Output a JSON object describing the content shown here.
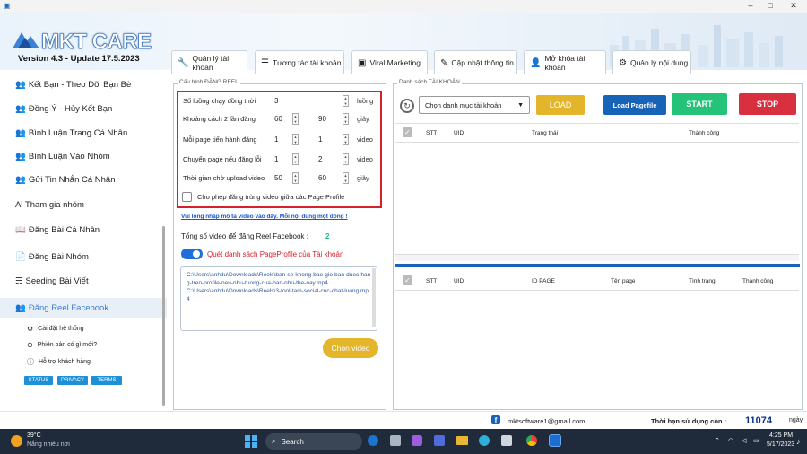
{
  "app": {
    "name": "MKT CARE",
    "version": "Version 4.3 - Update 17.5.2023"
  },
  "window": {
    "minimize": "–",
    "maximize": "□",
    "close": "✕"
  },
  "tabs": [
    {
      "label": "Quản lý tài khoản",
      "icon": "wrench-icon",
      "glyph": "🔧"
    },
    {
      "label": "Tương tác tài khoản",
      "icon": "list-icon",
      "glyph": "☰"
    },
    {
      "label": "Viral Marketing",
      "icon": "browser-icon",
      "glyph": "▣"
    },
    {
      "label": "Cập nhật thông tin",
      "icon": "pencil-icon",
      "glyph": "✎"
    },
    {
      "label": "Mở khóa tài khoản",
      "icon": "user-icon",
      "glyph": "👤"
    },
    {
      "label": "Quản lý nội dung",
      "icon": "gear-icon",
      "glyph": "⚙"
    }
  ],
  "sidebar": {
    "items": [
      {
        "label": "Kết Bạn - Theo Dõi Bạn Bè",
        "glyph": "👥"
      },
      {
        "label": "Đồng Ý - Hủy Kết Bạn",
        "glyph": "👥"
      },
      {
        "label": "Bình Luận Trang Cá Nhân",
        "glyph": "👥"
      },
      {
        "label": "Bình Luận Vào Nhóm",
        "glyph": "👥"
      },
      {
        "label": "Gửi Tin Nhắn Cá Nhân",
        "glyph": "👥"
      },
      {
        "label": "Tham gia nhóm",
        "glyph": "Aᴵ"
      },
      {
        "label": "Đăng Bài Cá Nhân",
        "glyph": "📖"
      },
      {
        "label": "Đăng Bài Nhóm",
        "glyph": "📄"
      },
      {
        "label": "Seeding Bài Viết",
        "glyph": "☴"
      },
      {
        "label": "Đăng Reel Facebook",
        "glyph": "👥"
      }
    ],
    "sub": [
      {
        "label": "Cài đặt hệ thống",
        "glyph": "⚙"
      },
      {
        "label": "Phiên bản có gì mới?",
        "glyph": "⊙"
      },
      {
        "label": "Hỗ trợ khách hàng",
        "glyph": "ⓘ"
      }
    ],
    "pills": [
      "STATUS",
      "PRIVACY",
      "TERMS"
    ]
  },
  "config": {
    "title": "Cấu hình ĐĂNG REEL",
    "rows": [
      {
        "label": "Số luồng chạy đồng thời",
        "v1": "3",
        "v2": "",
        "unit": "luồng"
      },
      {
        "label": "Khoảng cách 2 lần đăng",
        "v1": "60",
        "v2": "90",
        "unit": "giây"
      },
      {
        "label": "Mỗi page tiến hành đăng",
        "v1": "1",
        "v2": "1",
        "unit": "video"
      },
      {
        "label": "Chuyển page nếu đăng lỗi",
        "v1": "1",
        "v2": "2",
        "unit": "video"
      },
      {
        "label": "Thời gian chờ upload video",
        "v1": "50",
        "v2": "60",
        "unit": "giây"
      }
    ],
    "checkbox_label": "Cho phép đăng trùng video giữa các Page Profile",
    "link": "Vui lòng nhập mô tả video vào đây. Mỗi nội dung một dòng !",
    "total_label": "Tổng số video để đăng Reel Facebook :",
    "total_value": "2",
    "toggle_label": "Quét danh sách PageProfile của Tài khoản",
    "video_list": "C:\\Users\\anhdu\\Downloads\\Reels\\ban-se-khong-bao-gio-ban-duoc-hang-tren-profile-neu-nhu-tuong-cua-ban-nhu-the-nay.mp4\nC:\\Users\\anhdu\\Downloads\\Reels\\3-tool-tam-social-cuc-chat-luong.mp4",
    "choose_button": "Chọn video"
  },
  "accounts": {
    "title": "Danh sách TÀI KHOẢN",
    "dropdown": "Chọn danh mục tài khoản",
    "buttons": {
      "load": "LOAD",
      "loadpage": "Load Pagefile",
      "start": "START",
      "stop": "STOP"
    },
    "cols1": [
      "STT",
      "UID",
      "Trạng thái",
      "Thành công"
    ],
    "cols2": [
      "STT",
      "UID",
      "ID PAGE",
      "Tên page",
      "Tình trạng",
      "Thành công"
    ]
  },
  "footer": {
    "email": "mktsoftware1@gmail.com",
    "days_label": "Thời hạn sử dụng còn :",
    "days_value": "11074",
    "days_unit": "ngày"
  },
  "taskbar": {
    "temp": "39°C",
    "weather": "Nắng nhiều nơi",
    "search": "Search",
    "time": "4:25 PM",
    "date": "5/17/2023"
  },
  "colors": {
    "accent": "#1e90d6",
    "load": "#e3b52a",
    "loadpage": "#1763b8",
    "start": "#25c27a",
    "stop": "#d9303f",
    "red": "#d8202a"
  }
}
